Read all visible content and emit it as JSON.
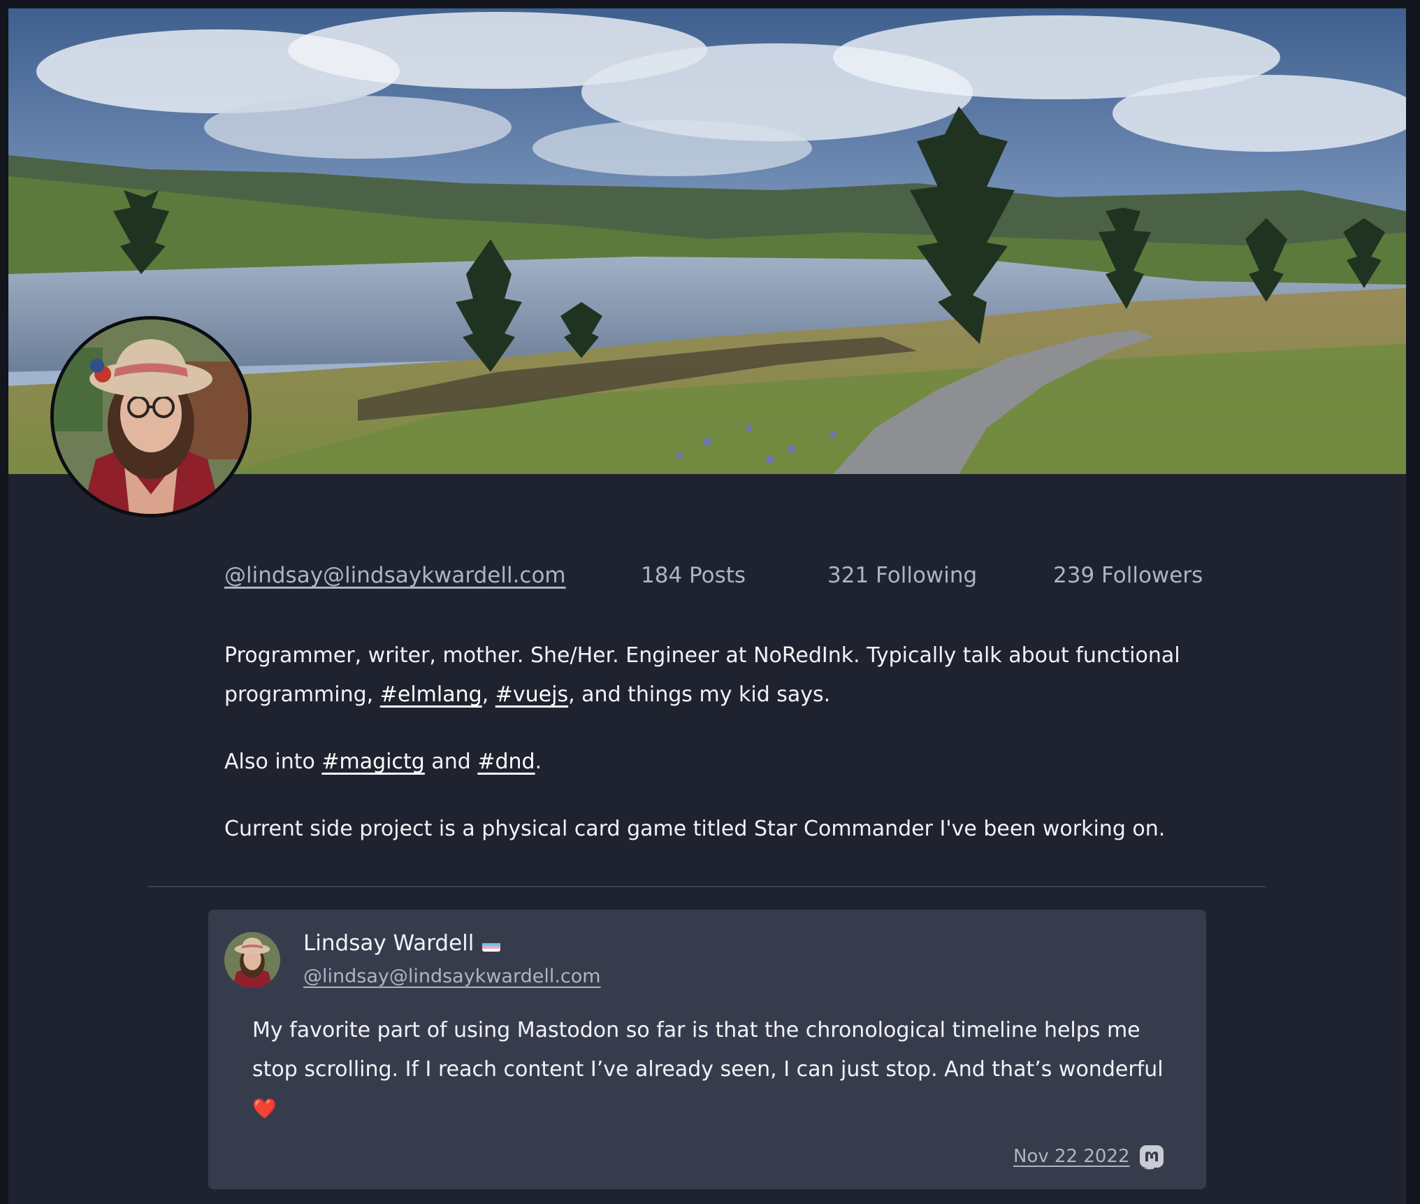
{
  "profile": {
    "handle": "@lindsay@lindsaykwardell.com",
    "posts": "184 Posts",
    "following": "321 Following",
    "followers": "239 Followers",
    "bio": {
      "p1_a": "Programmer, writer, mother. She/Her. Engineer at NoRedInk. Typically talk about functional programming, ",
      "tag_elmlang": "#elmlang",
      "sep1": ", ",
      "tag_vuejs": "#vuejs",
      "p1_b": ", and things my kid says.",
      "p2_a": "Also into ",
      "tag_magictg": "#magictg",
      "p2_b": " and ",
      "tag_dnd": "#dnd",
      "p2_c": ".",
      "p3": "Current side project is a physical card game titled Star Commander I've been working on."
    }
  },
  "post": {
    "author_name": "Lindsay Wardell",
    "author_flag_icon": "transgender-flag-icon",
    "author_handle": "@lindsay@lindsaykwardell.com",
    "text": "My favorite part of using Mastodon so far is that the chronological timeline helps me stop scrolling. If I reach content I’ve already seen, I can just stop. And that’s wonderful",
    "emoji": "❤️",
    "date": "Nov 22 2022",
    "source_icon": "mastodon-icon"
  },
  "colors": {
    "background": "#1f232f",
    "card": "#373c4d",
    "muted_text": "#aeb4c2",
    "text": "#f2f3f7"
  }
}
